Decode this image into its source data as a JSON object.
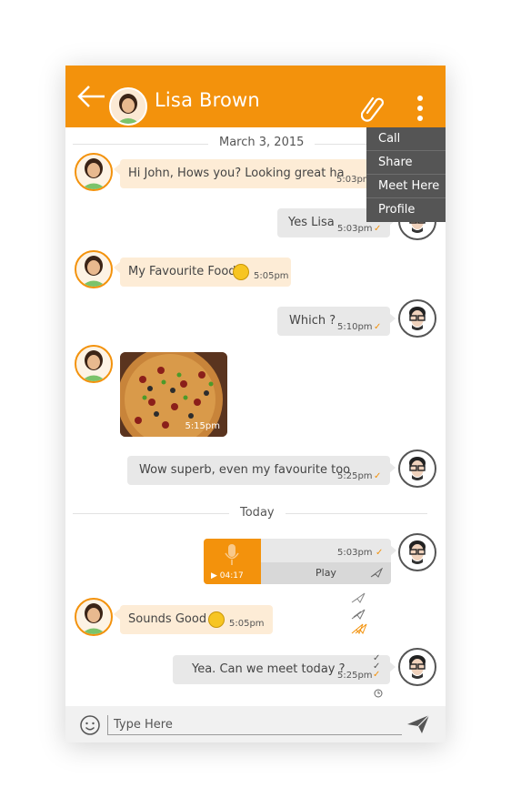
{
  "header": {
    "title": "Lisa Brown",
    "accent_color": "#f3920c",
    "back_icon": "arrow-left-icon",
    "attach_icon": "paperclip-icon",
    "more_icon": "vertical-dots-icon"
  },
  "menu": {
    "items": [
      "Call",
      "Share",
      "Meet Here",
      "Profile"
    ],
    "background": "#555555"
  },
  "separators": {
    "first_date": "March 3, 2015",
    "today": "Today"
  },
  "messages": [
    {
      "from": "Lisa",
      "text": "Hi John, Hows you? Looking great ha",
      "time": "5:03pm"
    },
    {
      "from": "John",
      "text": "Yes Lisa",
      "time": "5:03pm",
      "tick": "✓"
    },
    {
      "from": "Lisa",
      "text": "My Favourite Food",
      "time": "5:05pm",
      "emoji": "smile-emoji"
    },
    {
      "from": "John",
      "text": "Which ?",
      "time": "5:10pm",
      "tick": "✓"
    },
    {
      "from": "Lisa",
      "type": "image",
      "image": "pizza-photo",
      "time": "5:15pm"
    },
    {
      "from": "John",
      "text": "Wow superb, even my favourite too",
      "time": "5:25pm",
      "tick": "✓"
    },
    {
      "from": "John",
      "type": "voice",
      "duration": "04:17",
      "time": "5:03pm",
      "tick": "✓",
      "play_label": "Play"
    },
    {
      "from": "Lisa",
      "text": "Sounds Good",
      "time": "5:05pm",
      "emoji": "smile-emoji"
    },
    {
      "from": "John",
      "text": "Yea. Can we meet today ?",
      "time": "5:25pm",
      "tick": "✓"
    }
  ],
  "composer": {
    "placeholder": "Type Here",
    "emoji_icon": "smiley-icon",
    "send_icon": "send-icon"
  }
}
